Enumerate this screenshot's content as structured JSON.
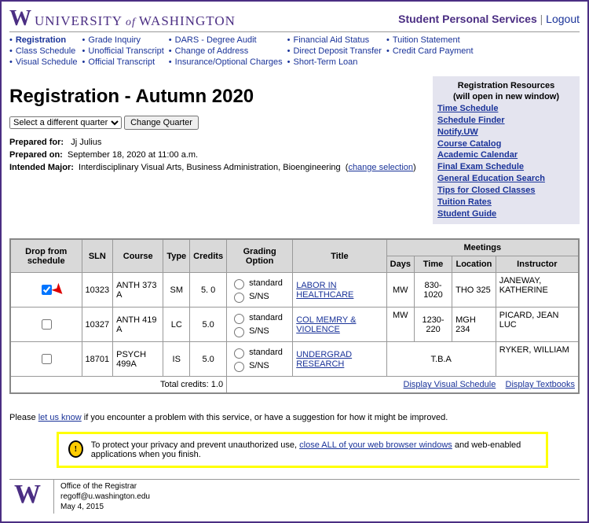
{
  "brand": {
    "w": "W",
    "u": "UNIVERSITY",
    "of": "of",
    "wa": "WASHINGTON"
  },
  "sps": {
    "title": "Student Personal Services",
    "logout": "Logout"
  },
  "nav": [
    [
      "Registration",
      "Class Schedule",
      "Visual Schedule"
    ],
    [
      "Grade Inquiry",
      "Unofficial Transcript",
      "Official Transcript"
    ],
    [
      "DARS - Degree Audit",
      "Change of Address",
      "Insurance/Optional Charges"
    ],
    [
      "Financial Aid Status",
      "Direct Deposit Transfer",
      "Short-Term Loan"
    ],
    [
      "Tuition Statement",
      "Credit Card Payment"
    ]
  ],
  "page_title": "Registration - Autumn 2020",
  "quarter_select": "Select a different quarter",
  "change_btn": "Change Quarter",
  "meta": {
    "prep_for_l": "Prepared for:",
    "prep_for_v": "Jj Julius",
    "prep_on_l": "Prepared on:",
    "prep_on_v": "September 18, 2020 at 11:00 a.m.",
    "major_l": "Intended Major:",
    "major_v": "Interdisciplinary Visual Arts,  Business Administration,  Bioengineering",
    "change_sel": "change selection"
  },
  "sidebar": {
    "title1": "Registration Resources",
    "title2": "(will open in new window)",
    "links": [
      "Time Schedule",
      "Schedule Finder",
      "Notify.UW",
      "Course Catalog",
      "Academic Calendar",
      "Final Exam Schedule",
      "General Education Search",
      "Tips for Closed Classes",
      "Tuition Rates",
      "Student Guide"
    ]
  },
  "th": {
    "drop": "Drop from schedule",
    "sln": "SLN",
    "course": "Course",
    "type": "Type",
    "credits": "Credits",
    "grading": "Grading Option",
    "title": "Title",
    "meetings": "Meetings",
    "days": "Days",
    "time": "Time",
    "loc": "Location",
    "instr": "Instructor"
  },
  "rows": [
    {
      "checked": true,
      "sln": "10323",
      "course": "ANTH 373 A",
      "type": "SM",
      "credits": "5. 0",
      "g1": "standard",
      "g2": "S/NS",
      "title": "LABOR IN HEALTHCARE",
      "days": "MW",
      "time": "830-1020",
      "loc": "THO 325",
      "instr": "JANEWAY, KATHERINE"
    },
    {
      "checked": false,
      "sln": "10327",
      "course": "ANTH 419 A",
      "type": "LC",
      "credits": "5.0",
      "g1": "standard",
      "g2": "S/NS",
      "title": "COL MEMRY & VIOLENCE",
      "days": "MW",
      "time": "1230-220",
      "loc": "MGH 234",
      "instr": "PICARD, JEAN LUC"
    },
    {
      "checked": false,
      "sln": "18701",
      "course": "PSYCH 499A",
      "type": "IS",
      "credits": "5.0",
      "g1": "standard",
      "g2": "S/NS",
      "title": "UNDERGRAD RESEARCH",
      "tba": "T.B.A",
      "instr": "RYKER, WILLIAM"
    }
  ],
  "totals": {
    "label": "Total credits: 1.0",
    "vs": "Display Visual Schedule",
    "tb": "Display Textbooks"
  },
  "problem": {
    "pre": "Please ",
    "link": "let us know",
    "post": " if you encounter a problem with this service, or have a suggestion for how it might be improved."
  },
  "notice": {
    "pre": "To protect your privacy and prevent unauthorized use, ",
    "link": "close ALL of your web browser windows",
    "post": " and web-enabled applications when you finish."
  },
  "footer": {
    "w": "W",
    "line1": "Office of the Registrar",
    "line2": "regoff@u.washington.edu",
    "line3": "May 4, 2015"
  }
}
